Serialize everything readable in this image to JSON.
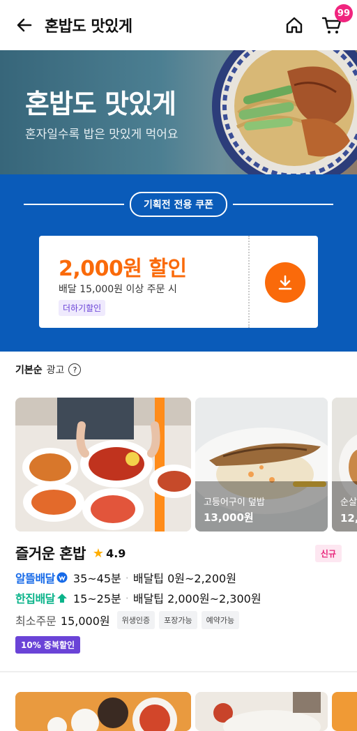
{
  "header": {
    "title": "혼밥도 맛있게",
    "cart_count": "99"
  },
  "banner": {
    "title": "혼밥도 맛있게",
    "subtitle": "혼자일수록 밥은 맛있게 먹어요"
  },
  "coupon": {
    "heading": "기획전 전용 쿠폰",
    "amount": "2,000원 할인",
    "condition": "배달 15,000원 이상 주문 시",
    "tag": "더하기할인"
  },
  "list": {
    "sort_label": "기본순",
    "ad_label": "광고",
    "help": "?"
  },
  "restaurant": {
    "photos": [
      {
        "label": "",
        "price": ""
      },
      {
        "label": "고등어구이 덮밥",
        "price": "13,000원"
      },
      {
        "label": "순살",
        "price": "12,"
      }
    ],
    "name": "즐거운 혼밥",
    "rating": "4.9",
    "new_badge": "신규",
    "delivery": [
      {
        "name": "알뜰배달",
        "time": "35~45분",
        "tip": "배달팁 0원~2,200원"
      },
      {
        "name": "한집배달",
        "time": "15~25분",
        "tip": "배달팁 2,000원~2,300원"
      }
    ],
    "min_order_label": "최소주문",
    "min_order_value": "15,000원",
    "chips": [
      "위생인증",
      "포장가능",
      "예약가능"
    ],
    "discount_badge": "10% 중복할인"
  },
  "colors": {
    "coupon_blue": "#0a5bb9",
    "accent_orange": "#fa6a0a",
    "badge_pink": "#f0247e",
    "alttle_blue": "#1569e8",
    "hanjib_green": "#0ab38a",
    "purple": "#6a43d7"
  }
}
